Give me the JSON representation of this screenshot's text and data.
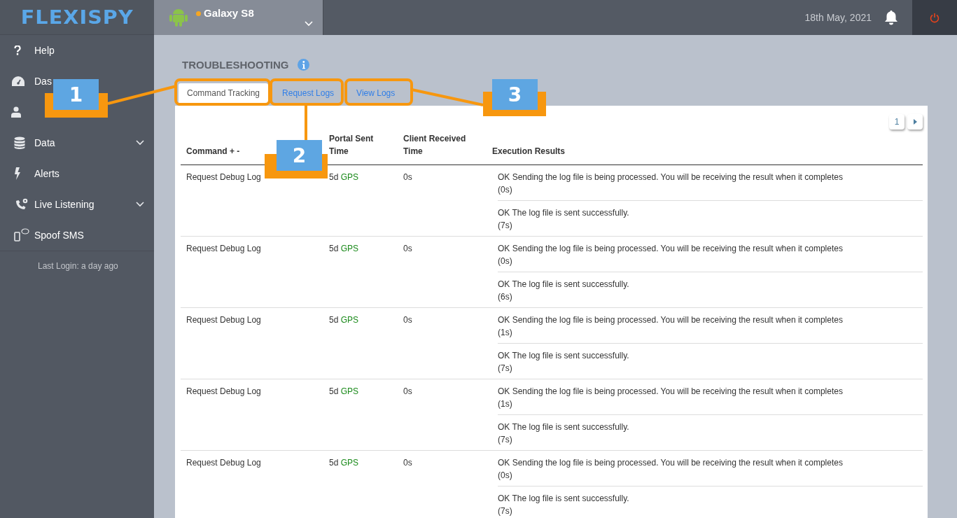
{
  "header": {
    "logo": "FLEXISPY",
    "device": "Galaxy S8",
    "device_online": true,
    "date": "18th May, 2021"
  },
  "sidebar": {
    "items": [
      {
        "label": "Help",
        "has_submenu": false
      },
      {
        "label": "Das",
        "has_submenu": false
      },
      {
        "has_submenu": false
      },
      {
        "label": "Data",
        "has_submenu": true
      },
      {
        "label": "Alerts",
        "has_submenu": false
      },
      {
        "label": "Live Listening",
        "has_submenu": true
      },
      {
        "label": "Spoof SMS",
        "has_submenu": false
      }
    ],
    "last_login": "Last Login: a day ago"
  },
  "page": {
    "title": "TROUBLESHOOTING",
    "tabs": [
      {
        "label": "Command Tracking",
        "selected": true,
        "highlighted": true
      },
      {
        "label": "Request Logs",
        "selected": false,
        "highlighted": true
      },
      {
        "label": "View Logs",
        "selected": false,
        "highlighted": true
      }
    ],
    "pagination": {
      "page": "1"
    },
    "table": {
      "columns": [
        "Command + -",
        "Portal Sent Time",
        "Client Received Time",
        "Execution Results"
      ],
      "rows": [
        {
          "command": "Request Debug Log",
          "portal_time": "5d",
          "portal_source": "GPS",
          "client_time": "0s",
          "results": [
            {
              "message": "OK Sending the log file is being processed. You will be receiving the result when it completes",
              "duration": "(0s)"
            },
            {
              "message": "OK The log file is sent successfully.",
              "duration": "(7s)"
            }
          ]
        },
        {
          "command": "Request Debug Log",
          "portal_time": "5d",
          "portal_source": "GPS",
          "client_time": "0s",
          "results": [
            {
              "message": "OK Sending the log file is being processed. You will be receiving the result when it completes",
              "duration": "(0s)"
            },
            {
              "message": "OK The log file is sent successfully.",
              "duration": "(6s)"
            }
          ]
        },
        {
          "command": "Request Debug Log",
          "portal_time": "5d",
          "portal_source": "GPS",
          "client_time": "0s",
          "results": [
            {
              "message": "OK Sending the log file is being processed. You will be receiving the result when it completes",
              "duration": "(1s)"
            },
            {
              "message": "OK The log file is sent successfully.",
              "duration": "(7s)"
            }
          ]
        },
        {
          "command": "Request Debug Log",
          "portal_time": "5d",
          "portal_source": "GPS",
          "client_time": "0s",
          "results": [
            {
              "message": "OK Sending the log file is being processed. You will be receiving the result when it completes",
              "duration": "(1s)"
            },
            {
              "message": "OK The log file is sent successfully.",
              "duration": "(7s)"
            }
          ]
        },
        {
          "command": "Request Debug Log",
          "portal_time": "5d",
          "portal_source": "GPS",
          "client_time": "0s",
          "results": [
            {
              "message": "OK Sending the log file is being processed. You will be receiving the result when it completes",
              "duration": "(0s)"
            },
            {
              "message": "OK The log file is sent successfully.",
              "duration": "(7s)"
            }
          ]
        }
      ]
    }
  },
  "callouts": [
    {
      "number": "1"
    },
    {
      "number": "2"
    },
    {
      "number": "3"
    }
  ]
}
